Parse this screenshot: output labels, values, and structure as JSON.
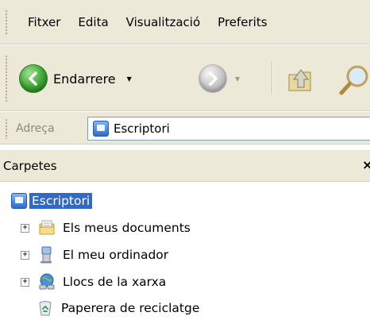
{
  "menubar": {
    "items": [
      "Fitxer",
      "Edita",
      "Visualització",
      "Preferits"
    ]
  },
  "toolbar": {
    "back_label": "Endarrere",
    "back_icon": "green-back-arrow",
    "forward_icon": "gray-forward-arrow",
    "up_icon": "folder-up",
    "search_icon": "magnifier"
  },
  "addressbar": {
    "label": "Adreça",
    "value": "Escriptori"
  },
  "folders_panel": {
    "title": "Carpetes",
    "close_glyph": "×",
    "tree": {
      "root": {
        "label": "Escriptori",
        "selected": true,
        "icon": "desktop-icon"
      },
      "children": [
        {
          "label": "Els meus documents",
          "expandable": true,
          "icon": "documents-folder-icon"
        },
        {
          "label": "El meu ordinador",
          "expandable": true,
          "icon": "computer-icon"
        },
        {
          "label": "Llocs de la xarxa",
          "expandable": true,
          "icon": "network-places-icon"
        },
        {
          "label": "Paperera de reciclatge",
          "expandable": false,
          "icon": "recycle-bin-icon"
        }
      ]
    }
  },
  "colors": {
    "chrome": "#ece9d8",
    "selection": "#316ac5",
    "address_border": "#7f9db9"
  }
}
